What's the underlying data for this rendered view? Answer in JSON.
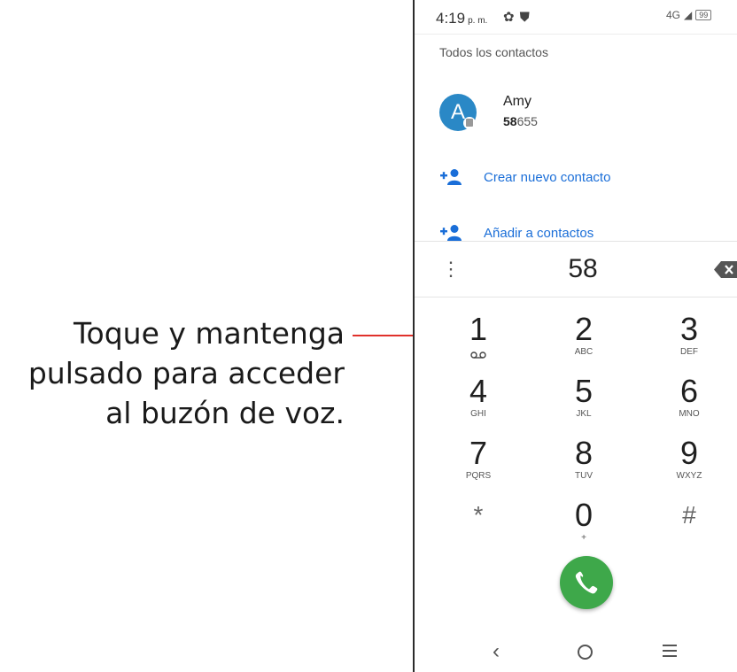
{
  "annotation": {
    "line1": "Toque y mantenga",
    "line2": "pulsado para acceder",
    "line3": "al buzón de voz.",
    "leader_color": "#e0312b"
  },
  "statusbar": {
    "time": "4:19",
    "ampm": "p. m.",
    "left_icons": [
      "gear-icon",
      "shield-icon"
    ],
    "network": "4G",
    "battery": "99"
  },
  "contacts": {
    "section_title": "Todos los contactos",
    "items": [
      {
        "initial": "A",
        "name": "Amy",
        "number_match": "58",
        "number_rest": "655"
      }
    ]
  },
  "actions": {
    "create": "Crear nuevo contacto",
    "add": "Añadir a contactos"
  },
  "dialer": {
    "digits": "58",
    "keys": [
      {
        "num": "1",
        "sub": "voicemail-icon"
      },
      {
        "num": "2",
        "sub": "ABC"
      },
      {
        "num": "3",
        "sub": "DEF"
      },
      {
        "num": "4",
        "sub": "GHI"
      },
      {
        "num": "5",
        "sub": "JKL"
      },
      {
        "num": "6",
        "sub": "MNO"
      },
      {
        "num": "7",
        "sub": "PQRS"
      },
      {
        "num": "8",
        "sub": "TUV"
      },
      {
        "num": "9",
        "sub": "WXYZ"
      },
      {
        "num": "*",
        "sub": ""
      },
      {
        "num": "0",
        "sub": "+"
      },
      {
        "num": "#",
        "sub": ""
      }
    ]
  },
  "colors": {
    "accent": "#1a6ed8",
    "avatar": "#2a88c6",
    "call": "#3ea84a"
  }
}
